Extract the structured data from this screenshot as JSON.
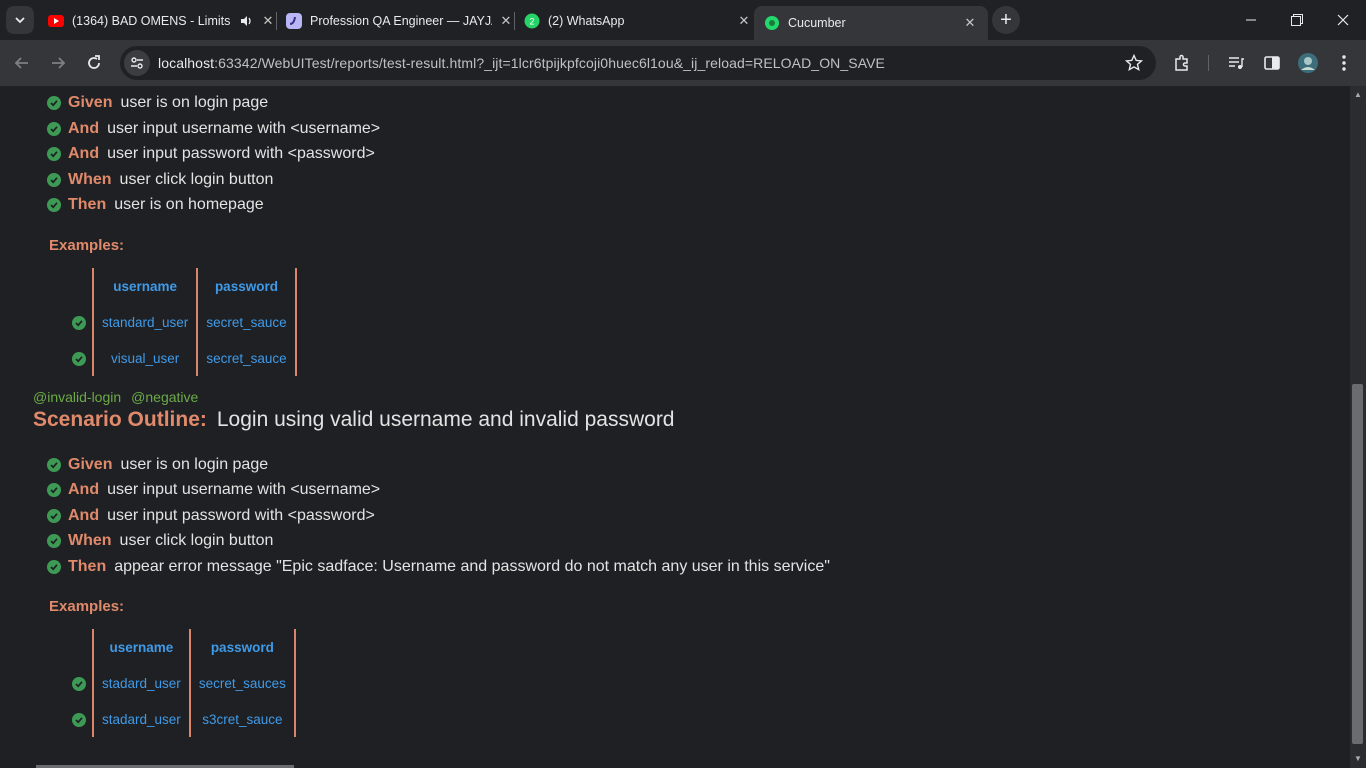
{
  "tabs": [
    {
      "title": "(1364) BAD OMENS - Limits",
      "icon": "youtube-icon",
      "audio": true
    },
    {
      "title": "Profession QA Engineer — JAYJA",
      "icon": "profession-site-icon"
    },
    {
      "title": "(2) WhatsApp",
      "icon": "whatsapp-icon",
      "badge": "2"
    },
    {
      "title": "Cucumber",
      "icon": "cucumber-icon",
      "active": true
    }
  ],
  "address": {
    "host": "localhost",
    "rest": ":63342/WebUITest/reports/test-result.html?_ijt=1lcr6tpijkpfcoji0huec6l1ou&_ij_reload=RELOAD_ON_SAVE"
  },
  "scenario1": {
    "steps": [
      {
        "kw": "Given",
        "text": "user is on login page"
      },
      {
        "kw": "And",
        "text": "user input username with <username>"
      },
      {
        "kw": "And",
        "text": "user input password with <password>"
      },
      {
        "kw": "When",
        "text": "user click login button"
      },
      {
        "kw": "Then",
        "text": "user is on homepage"
      }
    ],
    "examples_label": "Examples:",
    "headers": [
      "username",
      "password"
    ],
    "rows": [
      [
        "standard_user",
        "secret_sauce"
      ],
      [
        "visual_user",
        "secret_sauce"
      ]
    ]
  },
  "scenario2": {
    "tags": [
      "@invalid-login",
      "@negative"
    ],
    "keyword": "Scenario Outline:",
    "name": "Login using valid username and invalid password",
    "steps": [
      {
        "kw": "Given",
        "text": "user is on login page"
      },
      {
        "kw": "And",
        "text": "user input username with <username>"
      },
      {
        "kw": "And",
        "text": "user input password with <password>"
      },
      {
        "kw": "When",
        "text": "user click login button"
      },
      {
        "kw": "Then",
        "text": "appear error message \"Epic sadface: Username and password do not match any user in this service\""
      }
    ],
    "examples_label": "Examples:",
    "headers": [
      "username",
      "password"
    ],
    "rows": [
      [
        "stadard_user",
        "secret_sauces"
      ],
      [
        "stadard_user",
        "s3cret_sauce"
      ]
    ]
  },
  "colors": {
    "keyword": "#e08a6b",
    "tag": "#6cab48",
    "passed": "#3d9a55",
    "table_text": "#3f9ae8",
    "background": "#1f2023"
  }
}
